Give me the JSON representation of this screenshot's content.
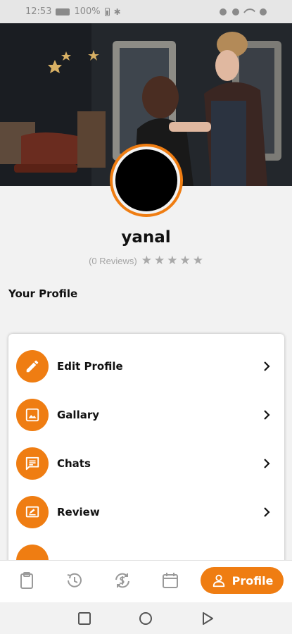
{
  "status_bar": {
    "time": "12:53",
    "battery": "100%"
  },
  "profile": {
    "name": "yanal",
    "reviews_text": "(0 Reviews)",
    "rating": 0,
    "max_rating": 5
  },
  "section": {
    "title": "Your Profile"
  },
  "menu": {
    "items": [
      {
        "label": "Edit Profile",
        "icon": "pencil-icon"
      },
      {
        "label": "Gallary",
        "icon": "image-icon"
      },
      {
        "label": "Chats",
        "icon": "chat-icon"
      },
      {
        "label": "Review",
        "icon": "review-icon"
      },
      {
        "label": "",
        "icon": "partial-icon"
      }
    ]
  },
  "bottom_nav": {
    "items": [
      {
        "icon": "clipboard-icon"
      },
      {
        "icon": "history-icon"
      },
      {
        "icon": "dollar-sync-icon"
      },
      {
        "icon": "calendar-icon"
      }
    ],
    "active_label": "Profile",
    "active_icon": "person-icon"
  },
  "colors": {
    "accent": "#ef7d12",
    "background": "#f2f2f2",
    "muted": "#a4a4a4"
  }
}
